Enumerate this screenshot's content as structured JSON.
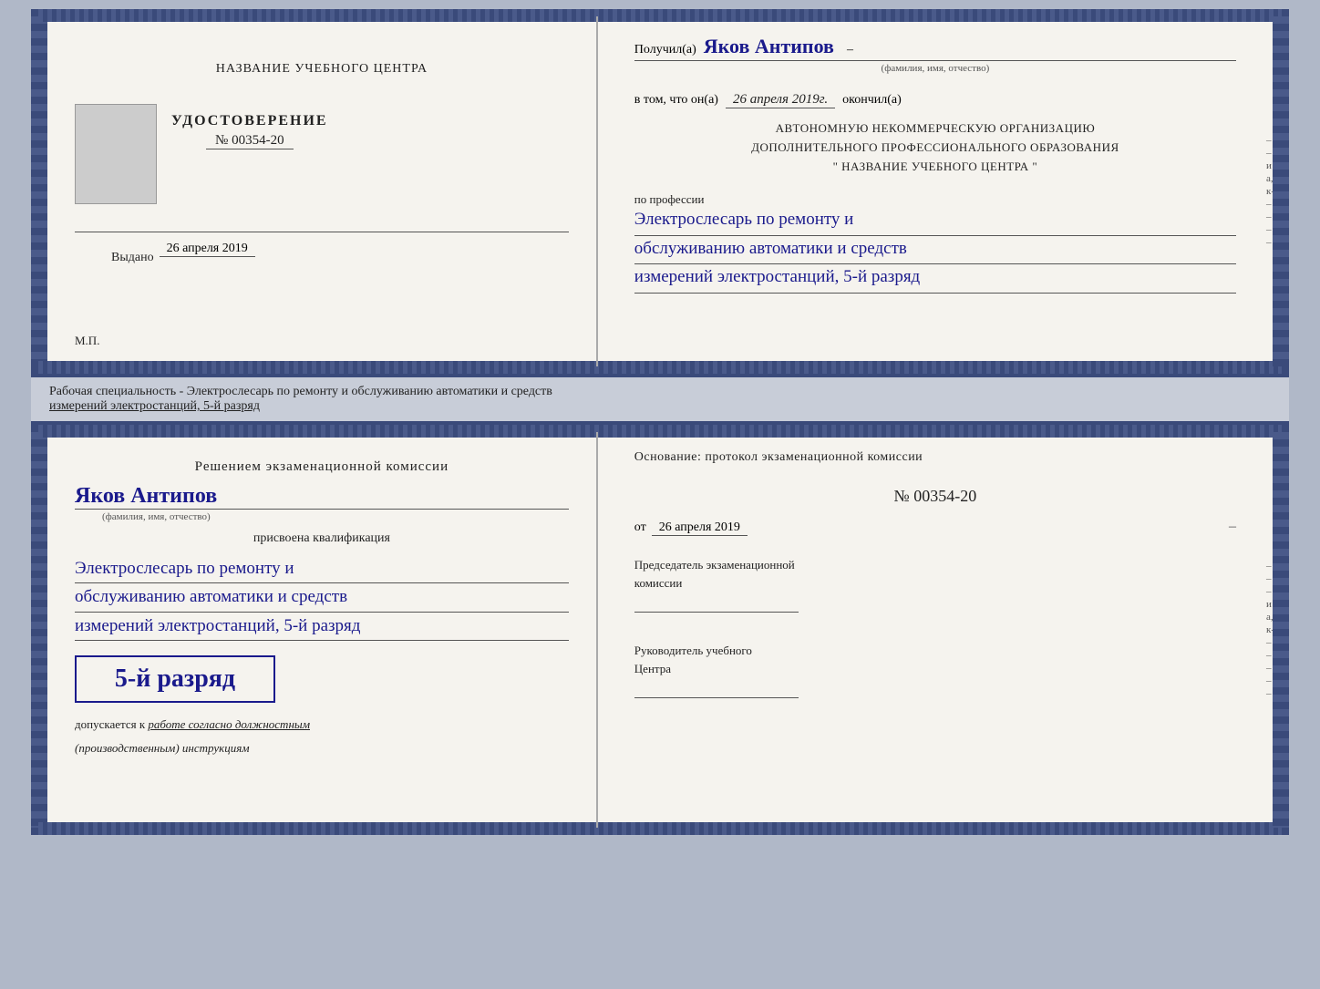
{
  "top_cert": {
    "left": {
      "center_title": "НАЗВАНИЕ УЧЕБНОГО ЦЕНТРА",
      "udostoverenie_label": "УДОСТОВЕРЕНИЕ",
      "number": "№ 00354-20",
      "issued_label": "Выдано",
      "issued_date": "26 апреля 2019",
      "mp_label": "М.П."
    },
    "right": {
      "received_prefix": "Получил(а)",
      "recipient_name": "Яков Антипов",
      "fio_subtitle": "(фамилия, имя, отчество)",
      "vtom_prefix": "в том, что он(а)",
      "completion_date": "26 апреля 2019г.",
      "okончил_label": "окончил(а)",
      "org_line1": "АВТОНОМНУЮ НЕКОММЕРЧЕСКУЮ ОРГАНИЗАЦИЮ",
      "org_line2": "ДОПОЛНИТЕЛЬНОГО ПРОФЕССИОНАЛЬНОГО ОБРАЗОВАНИЯ",
      "org_quote": "\" НАЗВАНИЕ УЧЕБНОГО ЦЕНТРА \"",
      "profession_prefix": "по профессии",
      "profession_line1": "Электрослесарь по ремонту и",
      "profession_line2": "обслуживанию автоматики и средств",
      "profession_line3": "измерений электростанций, 5-й разряд"
    }
  },
  "middle_band": {
    "text_line1": "Рабочая специальность - Электрослесарь по ремонту и обслуживанию автоматики и средств",
    "text_line2": "измерений электростанций, 5-й разряд"
  },
  "bottom_cert": {
    "left": {
      "decision_title": "Решением экзаменационной комиссии",
      "name": "Яков Антипов",
      "fio_subtitle": "(фамилия, имя, отчество)",
      "assigned_label": "присвоена квалификация",
      "qual_line1": "Электрослесарь по ремонту и",
      "qual_line2": "обслуживанию автоматики и средств",
      "qual_line3": "измерений электростанций, 5-й разряд",
      "rank_badge": "5-й разряд",
      "допускается_prefix": "допускается к",
      "допускается_italic": "работе согласно должностным",
      "инструкциям": "(производственным) инструкциям"
    },
    "right": {
      "osnov_label": "Основание: протокол экзаменационной комиссии",
      "protocol_number": "№ 00354-20",
      "protocol_date_prefix": "от",
      "protocol_date": "26 апреля 2019",
      "chairman_label": "Председатель экзаменационной",
      "chairman_label2": "комиссии",
      "head_label": "Руководитель учебного",
      "head_label2": "Центра"
    }
  }
}
